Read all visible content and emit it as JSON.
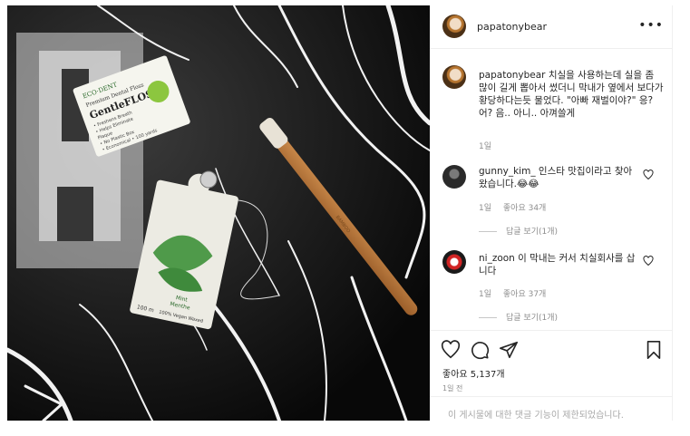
{
  "post": {
    "username": "papatonybear",
    "more_label": "•••"
  },
  "caption": {
    "username": "papatonybear",
    "text": " 치실을 사용하는데 실을 좀 많이 길게 뽑아서 썼더니 막내가 옆에서 보다가 황당하다는듯 물었다. \"아빠 재벌이야?\" 응? 어? 음.. 아니.. 아껴쓸게",
    "time": "1일"
  },
  "comments": [
    {
      "username": "gunny_kim_",
      "text": " 인스타 맛집이라고 찾아 왔습니다.😂😂",
      "time": "1일",
      "likes": "좋아요 34개",
      "replies": "답글 보기(1개)"
    },
    {
      "username": "ni_zoon",
      "text": " 이 막내는 커서 치실회사를 삽니다",
      "time": "1일",
      "likes": "좋아요 37개",
      "replies": "답글 보기(1개)"
    }
  ],
  "actions": {
    "likes": "좋아요 5,137개",
    "time_ago": "1일 전",
    "comments_disabled": "이 게시물에 대한 댓글 기능이 제한되었습니다."
  },
  "photo_text": {
    "brand": "ECO·DENT",
    "subtitle": "Premium Dental Floss",
    "product": "GentleFLOSS",
    "bullets": [
      "• Freshens Breath",
      "• Helps Eliminate",
      "  Plaque",
      "• No Plastic Box",
      "• Economical • 100 yards"
    ],
    "mint_line1": "Mint",
    "mint_line2": "Menthe",
    "amount": "100 m",
    "vegan": "100% Vegan Waxed",
    "toothbrush": "BAMBOO"
  },
  "colors": {
    "accent": "#262626",
    "secondary_text": "#8e8e8e",
    "divider": "#efefef"
  }
}
